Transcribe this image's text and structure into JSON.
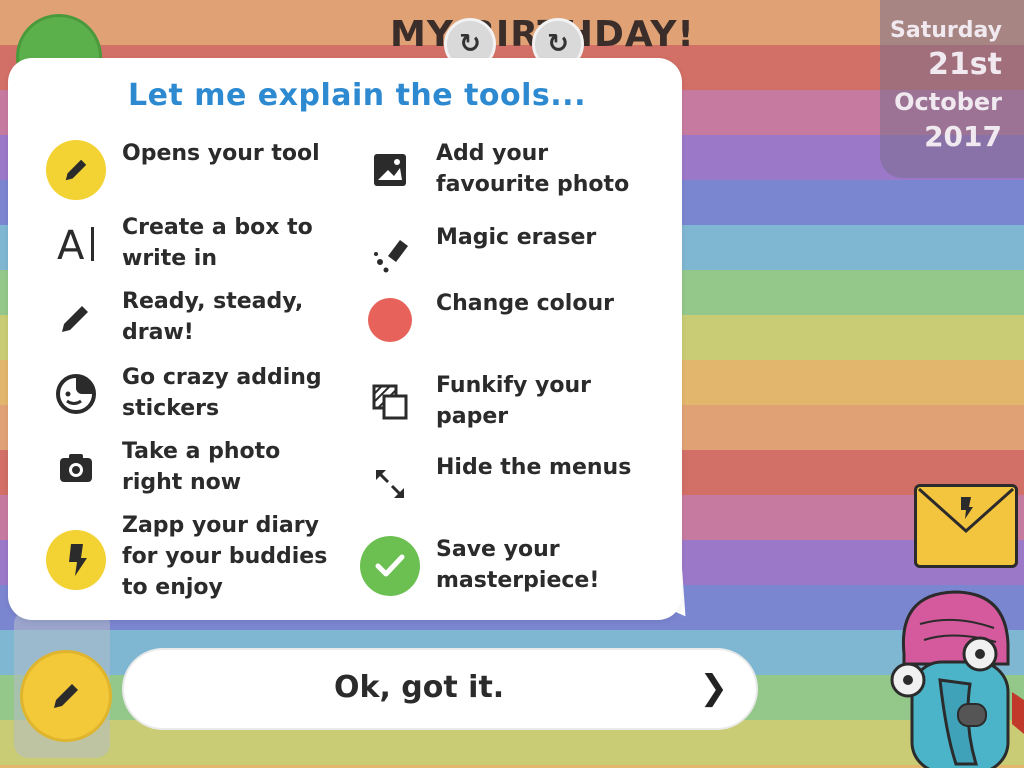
{
  "header": {
    "title": "MY BIRTHDAY!",
    "date": {
      "weekday": "Saturday",
      "day": "21st",
      "month": "October",
      "year": "2017"
    }
  },
  "tooltip": {
    "heading": "Let me explain the tools...",
    "left_items": [
      {
        "icon": "pencil-badge-icon",
        "label": "Opens your tool"
      },
      {
        "icon": "text-box-icon",
        "label": "Create a box to\nwrite in"
      },
      {
        "icon": "pencil-icon",
        "label": "Ready, steady,\ndraw!"
      },
      {
        "icon": "sticker-icon",
        "label": "Go crazy adding\nstickers"
      },
      {
        "icon": "camera-icon",
        "label": "Take a photo\nright now"
      },
      {
        "icon": "zapp-icon",
        "label": "Zapp your diary\nfor your buddies\nto enjoy"
      }
    ],
    "right_items": [
      {
        "icon": "photo-icon",
        "label": "Add your\nfavourite photo"
      },
      {
        "icon": "eraser-icon",
        "label": "Magic eraser"
      },
      {
        "icon": "colour-dot-icon",
        "label": "Change colour"
      },
      {
        "icon": "paper-pattern-icon",
        "label": "Funkify your\npaper"
      },
      {
        "icon": "expand-icon",
        "label": "Hide the menus"
      },
      {
        "icon": "check-icon",
        "label": "Save your\nmasterpiece!"
      }
    ]
  },
  "ok_button": {
    "label": "Ok, got it.",
    "chevron": "❯"
  },
  "colors": {
    "heading": "#2d8ad1",
    "yellow": "#f3d233",
    "red": "#e7625a",
    "green": "#6cc052"
  }
}
